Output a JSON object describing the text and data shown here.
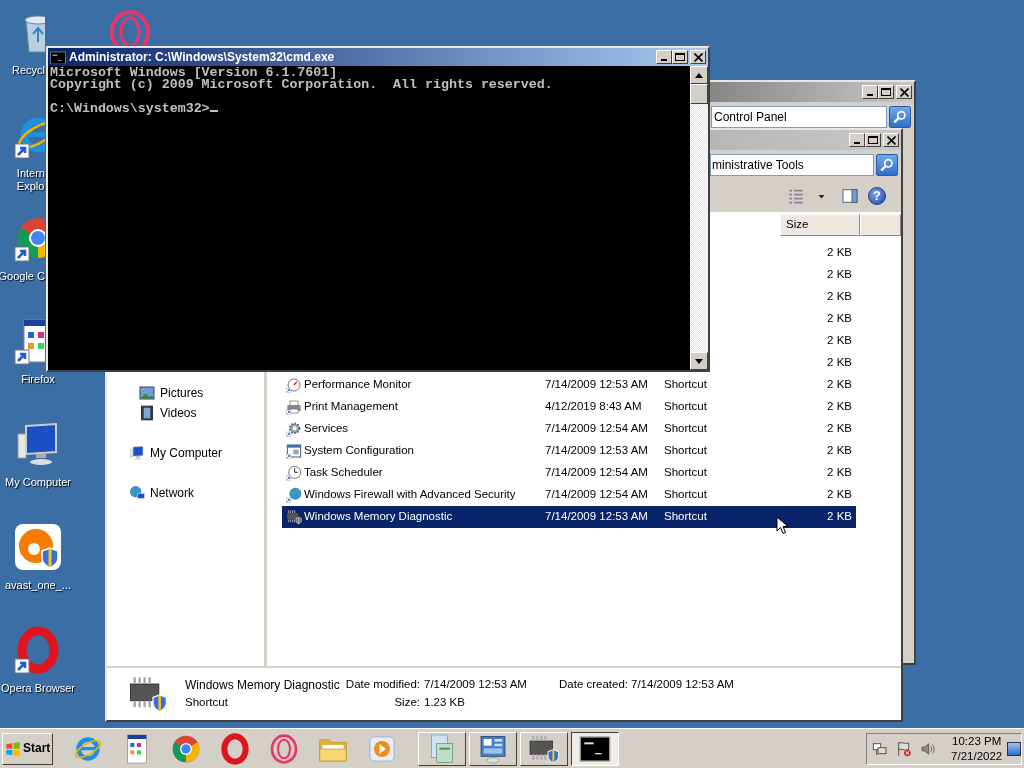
{
  "desktop_icons": [
    {
      "kind": "recycle",
      "shortcut": false,
      "label": [
        "Recycl"
      ]
    },
    {
      "kind": "ie",
      "shortcut": true,
      "label": [
        "Intern",
        "Explo"
      ]
    },
    {
      "kind": "chrome",
      "shortcut": true,
      "label": [
        "Google C"
      ]
    },
    {
      "kind": "app",
      "shortcut": true,
      "label": [
        "Firefox"
      ]
    },
    {
      "kind": "computer",
      "shortcut": false,
      "label": [
        "My Computer"
      ]
    },
    {
      "kind": "avast",
      "shortcut": false,
      "label": [
        "avast_one_..."
      ]
    },
    {
      "kind": "opera",
      "shortcut": true,
      "label": [
        "Opera Browser"
      ]
    },
    {
      "kind": "operagx",
      "shortcut": false
    }
  ],
  "control_panel_window": {
    "address": "Control Panel"
  },
  "explorer_window": {
    "address": "ministrative Tools",
    "help_glyph": "?",
    "columns": [
      {
        "label": "Size"
      }
    ],
    "nav": [
      {
        "children": [
          {
            "label": "Pictures",
            "kind": "pictures"
          },
          {
            "label": "Videos",
            "kind": "videos"
          }
        ]
      },
      {
        "label": "My Computer",
        "kind": "computer"
      },
      {
        "label": "Network",
        "kind": "network"
      }
    ],
    "rows": [
      {
        "size": "2 KB",
        "selected": false
      },
      {
        "size": "2 KB",
        "selected": false
      },
      {
        "size": "2 KB",
        "selected": false
      },
      {
        "size": "2 KB",
        "selected": false
      },
      {
        "size": "2 KB",
        "selected": false
      },
      {
        "size": "2 KB",
        "selected": false
      },
      {
        "kind": "gauge",
        "name": "Performance Monitor",
        "date": "7/14/2009 12:53 AM",
        "type": "Shortcut",
        "size": "2 KB",
        "selected": false
      },
      {
        "kind": "printer",
        "name": "Print Management",
        "date": "4/12/2019 8:43 AM",
        "type": "Shortcut",
        "size": "2 KB",
        "selected": false
      },
      {
        "kind": "gears",
        "name": "Services",
        "date": "7/14/2009 12:54 AM",
        "type": "Shortcut",
        "size": "2 KB",
        "selected": false
      },
      {
        "kind": "sysconfig",
        "name": "System Configuration",
        "date": "7/14/2009 12:53 AM",
        "type": "Shortcut",
        "size": "2 KB",
        "selected": false
      },
      {
        "kind": "clock",
        "name": "Task Scheduler",
        "date": "7/14/2009 12:54 AM",
        "type": "Shortcut",
        "size": "2 KB",
        "selected": false
      },
      {
        "kind": "globe",
        "name": "Windows Firewall with Advanced Security",
        "date": "7/14/2009 12:54 AM",
        "type": "Shortcut",
        "size": "2 KB",
        "selected": false
      },
      {
        "kind": "memchip",
        "name": "Windows Memory Diagnostic",
        "date": "7/14/2009 12:53 AM",
        "type": "Shortcut",
        "size": "2 KB",
        "selected": true
      }
    ],
    "details": {
      "name": "Windows Memory Diagnostic",
      "type": "Shortcut",
      "fields": [
        {
          "label": "Date modified:",
          "value": "7/14/2009 12:53 AM"
        },
        {
          "label": "Size:",
          "value": "1.23 KB"
        },
        {
          "label": "Date created:",
          "value": "7/14/2009 12:53 AM"
        }
      ]
    }
  },
  "cmd_window": {
    "title": "Administrator: C:\\Windows\\System32\\cmd.exe",
    "output_lines": [
      "Microsoft Windows [Version 6.1.7601]",
      "Copyright (c) 2009 Microsoft Corporation.  All rights reserved."
    ],
    "prompt": "C:\\Windows\\system32>"
  },
  "taskbar": {
    "start_label": "Start",
    "quick_launch": [
      {
        "kind": "ie"
      },
      {
        "kind": "app"
      },
      {
        "kind": "chrome"
      },
      {
        "kind": "opera"
      },
      {
        "kind": "operagx"
      },
      {
        "kind": "folder"
      },
      {
        "kind": "media"
      }
    ],
    "tasks": [
      {
        "kind": "doc",
        "selected": false
      },
      {
        "kind": "cp",
        "selected": false
      },
      {
        "kind": "memchip",
        "selected": false
      },
      {
        "kind": "cmd",
        "selected": true
      }
    ],
    "tray_icons": [
      {
        "kind": "network2"
      },
      {
        "kind": "flag"
      },
      {
        "kind": "speaker"
      }
    ],
    "time": "10:23 PM",
    "date": "7/21/2022"
  }
}
